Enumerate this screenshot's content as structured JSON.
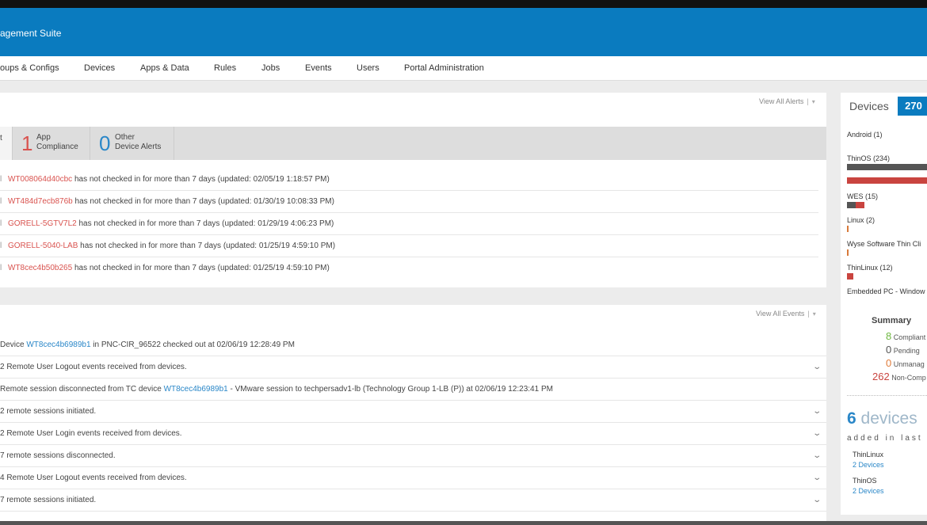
{
  "header": {
    "title": "agement Suite",
    "brand_color": "#0a7bbf"
  },
  "nav": [
    "oups & Configs",
    "Devices",
    "Apps & Data",
    "Rules",
    "Jobs",
    "Events",
    "Users",
    "Portal Administration"
  ],
  "alerts": {
    "view_all": "View All Alerts",
    "separator": "|",
    "caret": "▾",
    "tabs": [
      {
        "num": "",
        "label": "t"
      },
      {
        "num": "1",
        "label": "App\nCompliance"
      },
      {
        "num": "0",
        "label": "Other\nDevice Alerts"
      }
    ],
    "rows": [
      {
        "device": "WT008064d40cbc",
        "text": " has not checked in for more than 7 days (updated: 02/05/19 1:18:57 PM)"
      },
      {
        "device": "WT484d7ecb876b",
        "text": " has not checked in for more than 7 days (updated: 01/30/19 10:08:33 PM)"
      },
      {
        "device": "GORELL-5GTV7L2",
        "text": " has not checked in for more than 7 days (updated: 01/29/19 4:06:23 PM)"
      },
      {
        "device": "GORELL-5040-LAB",
        "text": " has not checked in for more than 7 days (updated: 01/25/19 4:59:10 PM)"
      },
      {
        "device": "WT8cec4b50b265",
        "text": " has not checked in for more than 7 days (updated: 01/25/19 4:59:10 PM)"
      }
    ],
    "row_prefix": "l"
  },
  "events": {
    "view_all": "View All Events",
    "separator": "|",
    "caret": "▾",
    "chevron": "⌄",
    "rows": [
      {
        "pre": "Device ",
        "link": "WT8cec4b6989b1",
        "post": " in PNC-CIR_96522 checked out at 02/06/19 12:28:49 PM",
        "expand": false
      },
      {
        "pre": "2 Remote User Logout events received from devices.",
        "link": "",
        "post": "",
        "expand": true
      },
      {
        "pre": "Remote session disconnected from TC device ",
        "link": "WT8cec4b6989b1",
        "post": " - VMware session to techpersadv1-lb (Technology Group 1-LB (P)) at 02/06/19 12:23:41 PM",
        "expand": false
      },
      {
        "pre": "2 remote sessions initiated.",
        "link": "",
        "post": "",
        "expand": true
      },
      {
        "pre": "2 Remote User Login events received from devices.",
        "link": "",
        "post": "",
        "expand": true
      },
      {
        "pre": "7 remote sessions disconnected.",
        "link": "",
        "post": "",
        "expand": true
      },
      {
        "pre": "4 Remote User Logout events received from devices.",
        "link": "",
        "post": "",
        "expand": true
      },
      {
        "pre": "7 remote sessions initiated.",
        "link": "",
        "post": "",
        "expand": true
      }
    ]
  },
  "devices": {
    "heading": "Devices",
    "total": "270",
    "os": [
      "Android (1)",
      "ThinOS (234)",
      "WES (15)",
      "Linux (2)",
      "Wyse Software Thin Cli",
      "ThinLinux (12)",
      "Embedded PC - Window"
    ],
    "summary": {
      "title": "Summary",
      "rows": [
        {
          "num": "8",
          "label": "Compliant",
          "color": "#6fb842"
        },
        {
          "num": "0",
          "label": "Pending",
          "color": "#555555"
        },
        {
          "num": "0",
          "label": "Unmanag",
          "color": "#e07b39"
        },
        {
          "num": "262",
          "label": "Non-Comp",
          "color": "#c9443f"
        }
      ]
    },
    "added": {
      "count": "6",
      "word": " devices",
      "sub": "added in last",
      "groups": [
        {
          "name": "ThinLinux",
          "count": "2 Devices"
        },
        {
          "name": "ThinOS",
          "count": "2 Devices"
        }
      ]
    }
  }
}
